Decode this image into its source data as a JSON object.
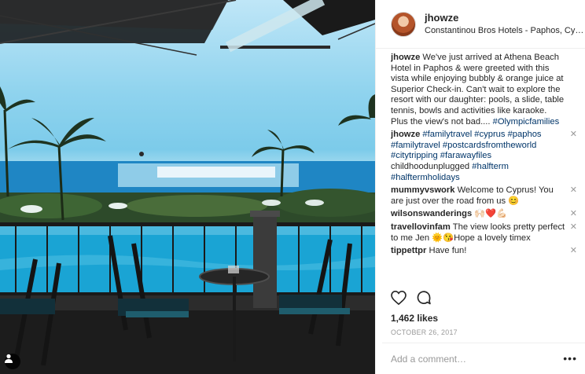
{
  "post": {
    "username": "jhowze",
    "location": "Constantinou Bros Hotels - Paphos, Cy…",
    "caption": {
      "author": "jhowze",
      "text": "We've just arrived at Athena Beach Hotel in Paphos & were greeted with this vista while enjoying bubbly & orange juice at Superior Check-in. Can't wait to explore the resort with our daughter: pools, a slide, table tennis, bowls and activities like karaoke. Plus the view's not bad....",
      "hashtag": "#Olympicfamilies"
    },
    "likes": "1,462 likes",
    "date": "October 26, 2017",
    "comment_placeholder": "Add a comment…",
    "more_icon": "•••"
  },
  "comments": [
    {
      "author": "jhowze",
      "hashtags": "#familytravel #cyprus #paphos #familytravel #postcardsfromtheworld #citytripping #farawayfiles",
      "text": "childhoodunplugged",
      "hashtags2": "#halfterm #halftermholidays",
      "deletable": true
    },
    {
      "author": "mummyvswork",
      "text": "Welcome to Cyprus! You are just over the road from us 😊",
      "deletable": true
    },
    {
      "author": "wilsonswanderings",
      "text": "🙌🏻❤️💪🏻",
      "deletable": true
    },
    {
      "author": "travellovinfam",
      "text": "The view looks pretty perfect to me Jen 🌞😘Hope a lovely timex",
      "deletable": true
    },
    {
      "author": "tippettpr",
      "text": "Have fun!",
      "deletable": true
    }
  ],
  "icons": {
    "like": "heart-icon",
    "comment": "comment-bubble-icon",
    "delete": "close-icon",
    "tag": "user-tag-icon"
  },
  "colors": {
    "text": "#262626",
    "hashtag": "#003569",
    "muted": "#999999",
    "border": "#efefef"
  }
}
